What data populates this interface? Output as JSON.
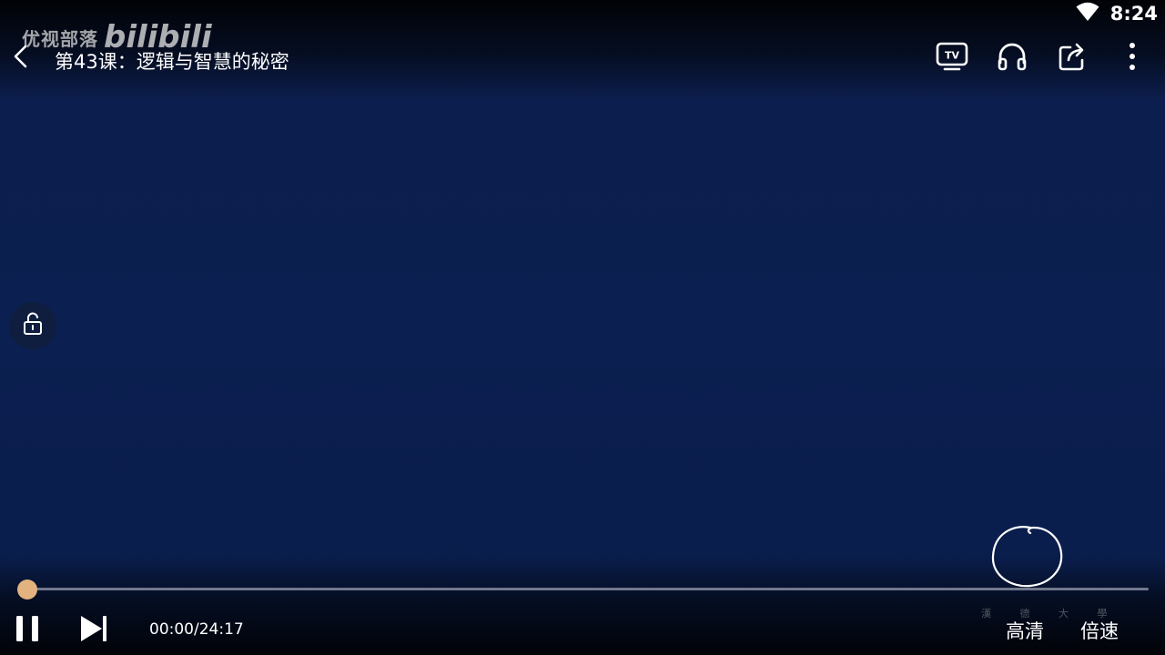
{
  "status_bar": {
    "time": "8:24",
    "wifi_icon": "wifi-icon"
  },
  "watermark": {
    "text": "优视部落",
    "logo_text": "bilibili"
  },
  "top_bar": {
    "back_icon": "back-arrow-icon",
    "title": "第43课：逻辑与智慧的秘密",
    "actions": [
      {
        "name": "tv-cast-icon"
      },
      {
        "name": "headphones-icon"
      },
      {
        "name": "share-icon"
      },
      {
        "name": "more-vertical-icon"
      }
    ]
  },
  "side": {
    "lock_icon": "unlock-icon"
  },
  "video_content": {
    "caption": "漢 德 大 學"
  },
  "player": {
    "progress": 0.0,
    "current_time": "00:00",
    "duration": "24:17",
    "time_text": "00:00/24:17",
    "quality_label": "高清",
    "speed_label": "倍速",
    "play_state": "playing",
    "accent_color": "#e2b27f"
  }
}
